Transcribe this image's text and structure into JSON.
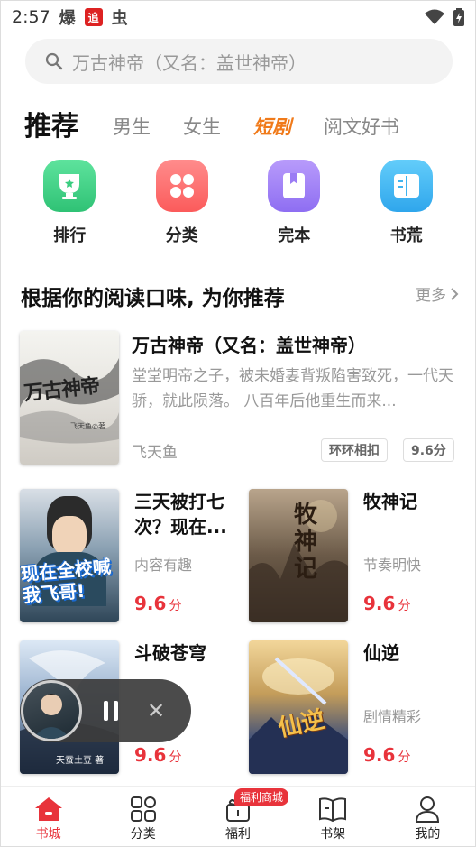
{
  "status_bar": {
    "time": "2:57",
    "icons": [
      "explosion-app-icon",
      "reading-app-icon",
      "bug-app-icon"
    ],
    "right_icons": [
      "wifi-icon",
      "battery-icon"
    ]
  },
  "search": {
    "placeholder": "万古神帝（又名：盖世神帝）"
  },
  "tabs": [
    {
      "label": "推荐",
      "active": true
    },
    {
      "label": "男生"
    },
    {
      "label": "女生"
    },
    {
      "label": "短剧",
      "highlight": true
    },
    {
      "label": "阅文好书"
    }
  ],
  "quick_entries": [
    {
      "label": "排行",
      "icon": "trophy-icon",
      "color": "#3fcf84"
    },
    {
      "label": "分类",
      "icon": "grid-icon",
      "color": "#ff6b6b"
    },
    {
      "label": "完本",
      "icon": "bookmark-icon",
      "color": "#9b7cf4"
    },
    {
      "label": "书荒",
      "icon": "book-icon",
      "color": "#3fb4f0"
    }
  ],
  "section": {
    "title": "根据你的阅读口味, 为你推荐",
    "more": "更多"
  },
  "featured": {
    "title": "万古神帝（又名：盖世神帝）",
    "description": "堂堂明帝之子，被未婚妻背叛陷害致死，一代天骄，就此陨落。 八百年后他重生而来...",
    "author": "飞天鱼",
    "tags": [
      "环环相扣",
      "9.6分"
    ],
    "cover_text": "万古神帝",
    "cover_author": "飞天鱼◎著"
  },
  "books": [
    {
      "title": "三天被打七次？现在...",
      "tag": "内容有趣",
      "score": "9.6",
      "unit": "分",
      "cover_text": "现在全校喊我飞哥!"
    },
    {
      "title": "牧神记",
      "tag": "节奏明快",
      "score": "9.6",
      "unit": "分",
      "cover_text": "牧神记"
    },
    {
      "title": "斗破苍穹",
      "tag": "",
      "score": "9.6",
      "unit": "分",
      "cover_text": "天蚕土豆 著"
    },
    {
      "title": "仙逆",
      "tag": "剧情精彩",
      "score": "9.6",
      "unit": "分",
      "cover_text": "仙逆"
    }
  ],
  "player": {
    "state": "playing"
  },
  "bottom_nav": [
    {
      "label": "书城",
      "icon": "home-icon",
      "active": true
    },
    {
      "label": "分类",
      "icon": "category-icon"
    },
    {
      "label": "福利",
      "icon": "gift-icon",
      "promo": "福利商城"
    },
    {
      "label": "书架",
      "icon": "bookshelf-icon"
    },
    {
      "label": "我的",
      "icon": "profile-icon"
    }
  ],
  "colors": {
    "accent": "#e8333b",
    "short_drama": "#f07a1a"
  }
}
